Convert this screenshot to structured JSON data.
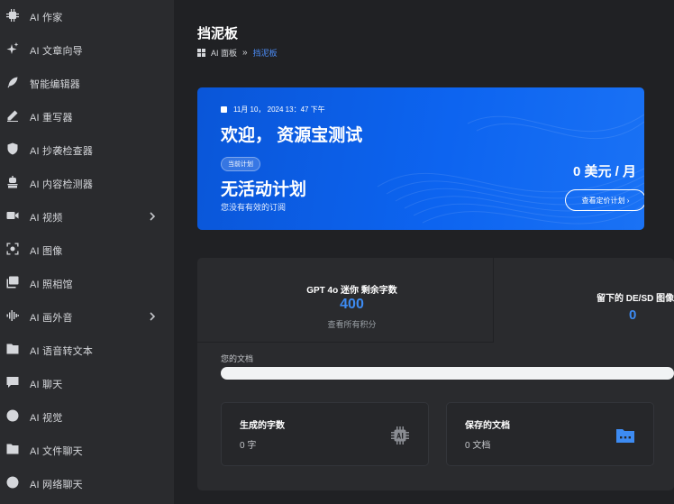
{
  "sidebar": {
    "items": [
      {
        "label": "AI 作家",
        "icon": "chip-icon"
      },
      {
        "label": "AI 文章向导",
        "icon": "sparkle-icon"
      },
      {
        "label": "智能编辑器",
        "icon": "feather-icon"
      },
      {
        "label": "AI 重写器",
        "icon": "pencil-icon"
      },
      {
        "label": "AI 抄袭检查器",
        "icon": "shield-icon"
      },
      {
        "label": "AI 内容检测器",
        "icon": "detector-icon"
      },
      {
        "label": "AI 视频",
        "icon": "video-icon"
      },
      {
        "label": "AI 图像",
        "icon": "image-scan-icon"
      },
      {
        "label": "AI 照相馆",
        "icon": "gallery-icon"
      },
      {
        "label": "AI 画外音",
        "icon": "voice-wave-icon"
      },
      {
        "label": "AI 语音转文本",
        "icon": "speech-text-icon"
      },
      {
        "label": "AI 聊天",
        "icon": "chat-icon"
      },
      {
        "label": "AI 视觉",
        "icon": "brain-icon"
      },
      {
        "label": "AI 文件聊天",
        "icon": "file-chat-icon"
      },
      {
        "label": "AI 网络聊天",
        "icon": "globe-icon"
      }
    ]
  },
  "header": {
    "title": "挡泥板",
    "breadcrumb": {
      "parent": "AI 面板",
      "separator": "»",
      "current": "挡泥板"
    }
  },
  "hero": {
    "date": "11月 10， 2024 13：47 下午",
    "welcome": "欢迎， 资源宝测试",
    "badge": "当前计划",
    "plan_name": "无活动计划",
    "plan_sub": "您没有有效的订阅",
    "price": "0 美元 / 月",
    "pricing_button": "查看定价计划 ›"
  },
  "stats": {
    "words_title": "GPT 4o 迷你 剩余字数",
    "words_value": "400",
    "words_link": "查看所有积分",
    "images_title": "留下的 DE/SD 图像",
    "images_value": "0",
    "docs_label": "您的文档"
  },
  "cards": [
    {
      "title": "生成的字数",
      "value": "0 字",
      "icon": "ai-chip-icon"
    },
    {
      "title": "保存的文档",
      "value": "0 文档",
      "icon": "folder-icon"
    }
  ],
  "colors": {
    "accent": "#3d8bf2",
    "hero_blue": "#0d64f0",
    "sidebar_bg": "#2a2b2e",
    "page_bg": "#202124"
  }
}
